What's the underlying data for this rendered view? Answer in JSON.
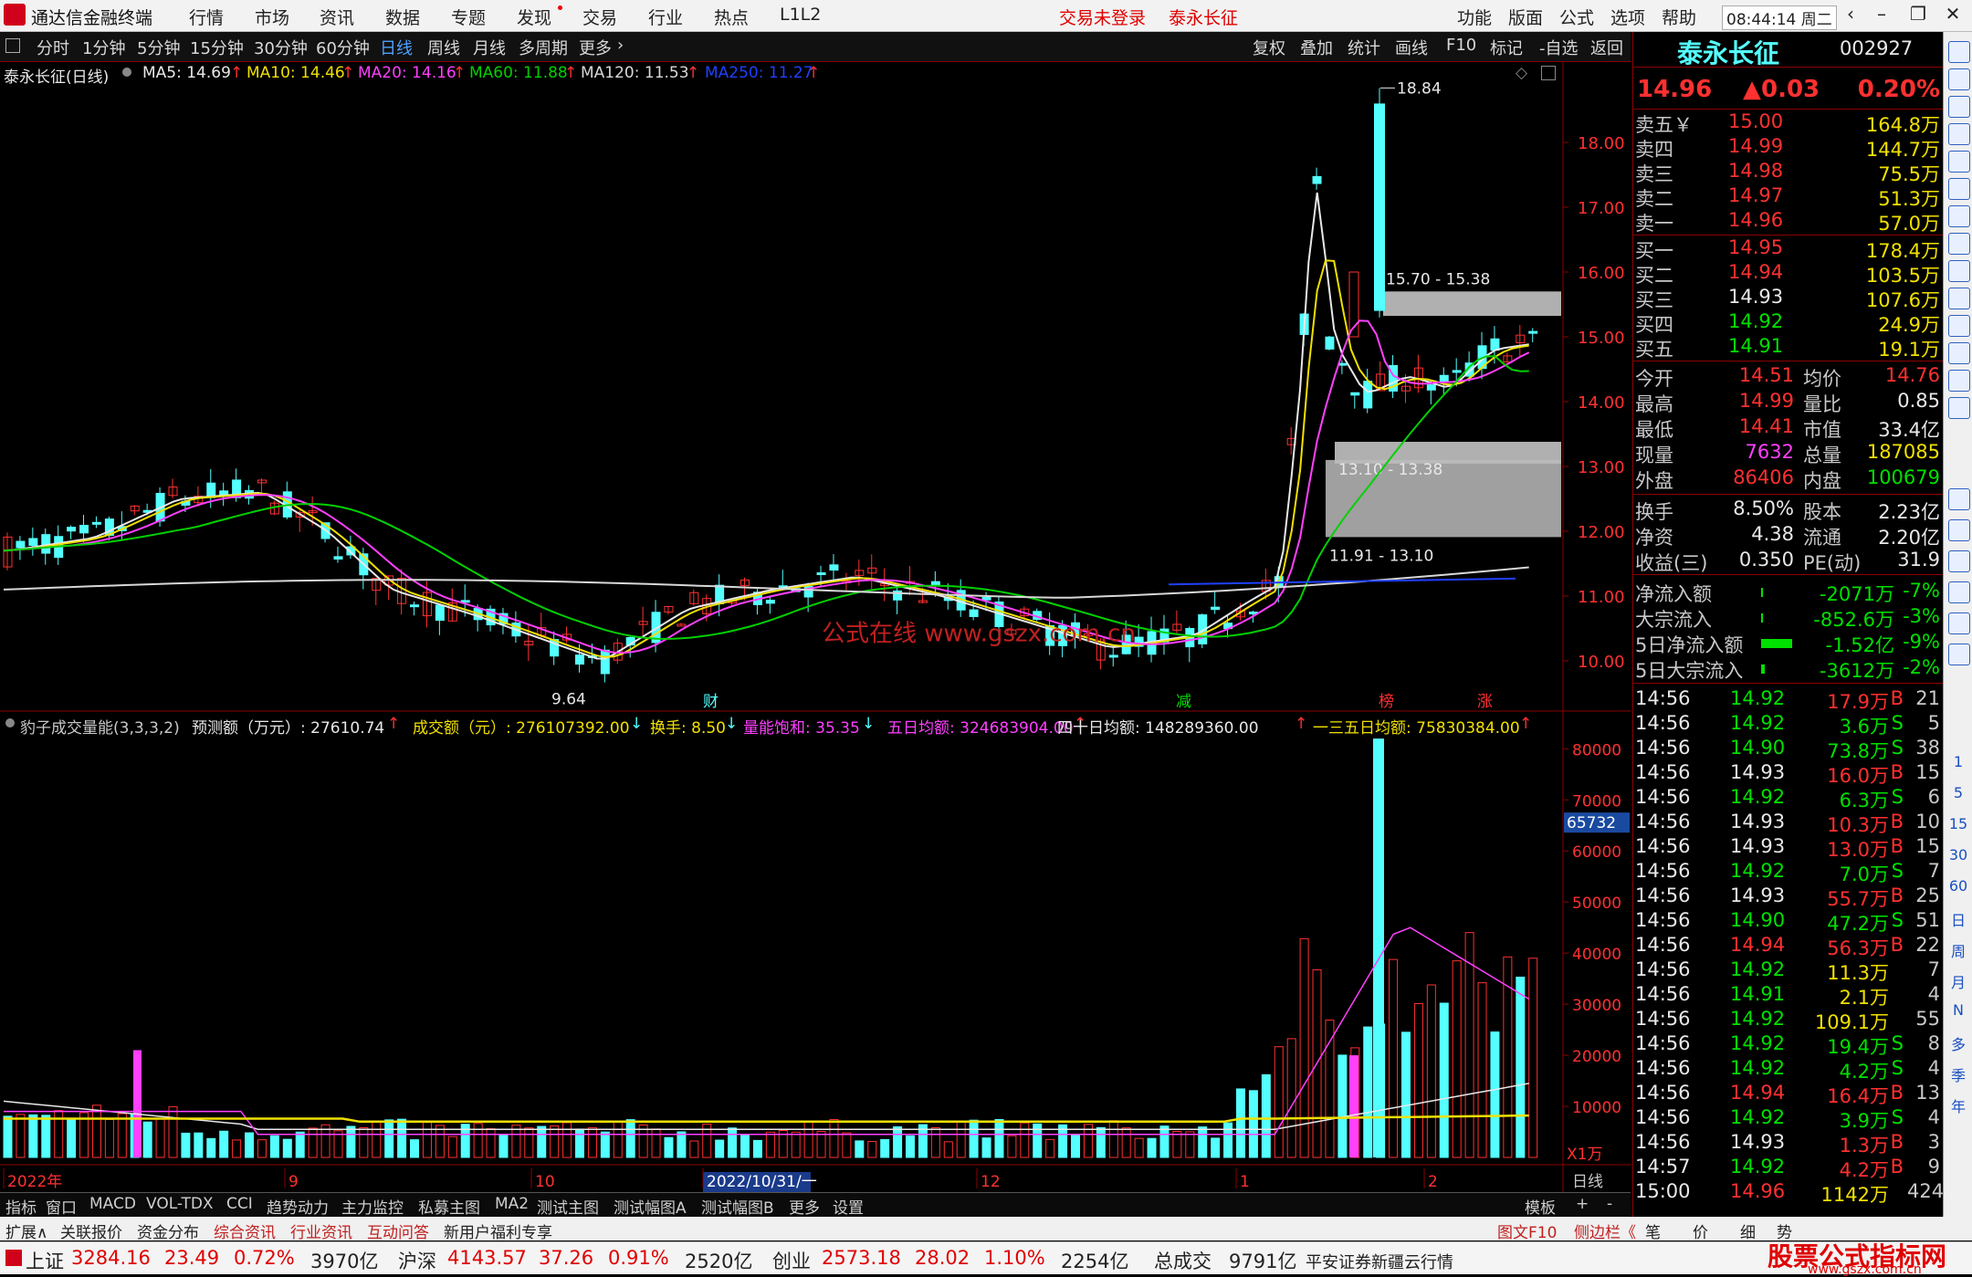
{
  "menubar": {
    "app_title": "通达信金融终端",
    "items": [
      "行情",
      "市场",
      "资讯",
      "数据",
      "专题",
      "发现",
      "交易",
      "行业",
      "热点",
      "L1L2"
    ],
    "status_login": "交易未登录",
    "stock_name": "泰永长征",
    "right_items": [
      "功能",
      "版面",
      "公式",
      "选项",
      "帮助"
    ],
    "time": "08:44:14",
    "weekday": "周二"
  },
  "toolbar": {
    "periods": [
      "分时",
      "1分钟",
      "5分钟",
      "15分钟",
      "30分钟",
      "60分钟",
      "日线",
      "周线",
      "月线",
      "多周期",
      "更多"
    ],
    "active": "日线",
    "right_buttons": [
      "复权",
      "叠加",
      "统计",
      "画线",
      "F10",
      "标记",
      "-自选",
      "返回"
    ]
  },
  "ma_line": {
    "title": "泰永长征(日线)",
    "items": [
      {
        "label": "MA5: 14.69",
        "color": "#e8e8e8"
      },
      {
        "label": "MA10: 14.46",
        "color": "#f0e000"
      },
      {
        "label": "MA20: 14.16",
        "color": "#ff40ff"
      },
      {
        "label": "MA60: 11.88",
        "color": "#00d000"
      },
      {
        "label": "MA120: 11.53",
        "color": "#e0e0e0"
      },
      {
        "label": "MA250: 11.27",
        "color": "#2040ff"
      }
    ]
  },
  "price_axis": [
    "18.00",
    "17.00",
    "16.00",
    "15.00",
    "14.00",
    "13.00",
    "12.00",
    "11.00",
    "10.00"
  ],
  "annotations": {
    "high": "18.84",
    "low": "9.64",
    "zone1": "15.70 - 15.38",
    "zone2": "13.10 - 13.38",
    "zone3": "11.91 - 13.10",
    "watermark": "公式在线  www.gszx.com.cn",
    "markers": [
      "财",
      "减",
      "榜",
      "涨"
    ]
  },
  "volume_header": {
    "title": "豹子成交量能(3,3,3,2)",
    "items": [
      {
        "label": "预测额（万元）: 27610.74",
        "color": "#e8e8e8"
      },
      {
        "label": "成交额（元）: 276107392.00",
        "color": "#f0e000"
      },
      {
        "label": "换手: 8.50",
        "color": "#f0e000"
      },
      {
        "label": "量能饱和: 35.35",
        "color": "#ff40ff"
      },
      {
        "label": "五日均额: 324683904.00",
        "color": "#ff40ff"
      },
      {
        "label": "四十日均额: 148289360.00",
        "color": "#e8e8e8"
      },
      {
        "label": "一三五日均额: 75830384.00",
        "color": "#f0e000"
      }
    ]
  },
  "volume_axis": [
    "80000",
    "70000",
    "60000",
    "50000",
    "40000",
    "30000",
    "20000",
    "10000"
  ],
  "volume_current": "65732",
  "volume_unit": "X1万",
  "date_axis": [
    "2022年",
    "9",
    "10",
    "2022/10/31/一",
    "12",
    "1",
    "2"
  ],
  "date_axis_right": "日线",
  "tabs1": [
    "指标",
    "窗口",
    "MACD",
    "VOL-TDX",
    "CCI",
    "趋势动力",
    "主力监控",
    "私募主图",
    "MA2",
    "测试主图",
    "测试幅图A",
    "测试幅图B",
    "更多",
    "设置"
  ],
  "tabs1_right": [
    "模板",
    "+",
    "-"
  ],
  "tabs2": [
    "扩展∧",
    "关联报价",
    "资金分布",
    "综合资讯",
    "行业资讯",
    "互动问答",
    "新用户福利专享"
  ],
  "tabs2_right": [
    "图文F10",
    "侧边栏《",
    "笔",
    "价",
    "细",
    "势"
  ],
  "statusbar": [
    {
      "label": "上证",
      "value": "3284.16",
      "chg": "23.49",
      "pct": "0.72%",
      "amt": "3970亿"
    },
    {
      "label": "沪深",
      "value": "4143.57",
      "chg": "37.26",
      "pct": "0.91%",
      "amt": "2520亿"
    },
    {
      "label": "创业",
      "value": "2573.18",
      "chg": "28.02",
      "pct": "1.10%",
      "amt": "2254亿"
    }
  ],
  "status_total_label": "总成交",
  "status_total": "9791亿",
  "status_broker": "平安证券新疆云行情",
  "status_brand": "股票公式指标网",
  "status_brand_url": "www.gszx.com.cn",
  "quote": {
    "name": "泰永长征",
    "code": "002927",
    "price": "14.96",
    "change": "▲0.03",
    "pct": "0.20%",
    "asks": [
      {
        "label": "卖五￥",
        "price": "15.00",
        "vol": "164.8万"
      },
      {
        "label": "卖四",
        "price": "14.99",
        "vol": "144.7万"
      },
      {
        "label": "卖三",
        "price": "14.98",
        "vol": "75.5万"
      },
      {
        "label": "卖二",
        "price": "14.97",
        "vol": "51.3万"
      },
      {
        "label": "卖一",
        "price": "14.96",
        "vol": "57.0万"
      }
    ],
    "bids": [
      {
        "label": "买一",
        "price": "14.95",
        "vol": "178.4万"
      },
      {
        "label": "买二",
        "price": "14.94",
        "vol": "103.5万"
      },
      {
        "label": "买三",
        "price": "14.93",
        "vol": "107.6万"
      },
      {
        "label": "买四",
        "price": "14.92",
        "vol": "24.9万"
      },
      {
        "label": "买五",
        "price": "14.91",
        "vol": "19.1万"
      }
    ],
    "stats": [
      {
        "l1": "今开",
        "v1": "14.51",
        "l2": "均价",
        "v2": "14.76"
      },
      {
        "l1": "最高",
        "v1": "14.99",
        "l2": "量比",
        "v2": "0.85"
      },
      {
        "l1": "最低",
        "v1": "14.41",
        "l2": "市值",
        "v2": "33.4亿"
      },
      {
        "l1": "现量",
        "v1": "7632",
        "l2": "总量",
        "v2": "187085"
      },
      {
        "l1": "外盘",
        "v1": "86406",
        "l2": "内盘",
        "v2": "100679"
      }
    ],
    "stats2": [
      {
        "l1": "换手",
        "v1": "8.50%",
        "l2": "股本",
        "v2": "2.23亿"
      },
      {
        "l1": "净资",
        "v1": "4.38",
        "l2": "流通",
        "v2": "2.20亿"
      },
      {
        "l1": "收益(三)",
        "v1": "0.350",
        "l2": "PE(动)",
        "v2": "31.9"
      }
    ],
    "flows": [
      {
        "label": "净流入额",
        "value": "-2071万",
        "pct": "-7%"
      },
      {
        "label": "大宗流入",
        "value": "-852.6万",
        "pct": "-3%"
      },
      {
        "label": "5日净流入额",
        "value": "-1.52亿",
        "pct": "-9%"
      },
      {
        "label": "5日大宗流入",
        "value": "-3612万",
        "pct": "-2%"
      }
    ],
    "ticks": [
      {
        "t": "14:56",
        "p": "14.92",
        "v": "17.9万",
        "s": "B",
        "n": "21"
      },
      {
        "t": "14:56",
        "p": "14.92",
        "v": "3.6万",
        "s": "S",
        "n": "5"
      },
      {
        "t": "14:56",
        "p": "14.90",
        "v": "73.8万",
        "s": "S",
        "n": "38"
      },
      {
        "t": "14:56",
        "p": "14.93",
        "v": "16.0万",
        "s": "B",
        "n": "15"
      },
      {
        "t": "14:56",
        "p": "14.92",
        "v": "6.3万",
        "s": "S",
        "n": "6"
      },
      {
        "t": "14:56",
        "p": "14.93",
        "v": "10.3万",
        "s": "B",
        "n": "10"
      },
      {
        "t": "14:56",
        "p": "14.93",
        "v": "13.0万",
        "s": "B",
        "n": "15"
      },
      {
        "t": "14:56",
        "p": "14.92",
        "v": "7.0万",
        "s": "S",
        "n": "7"
      },
      {
        "t": "14:56",
        "p": "14.93",
        "v": "55.7万",
        "s": "B",
        "n": "25"
      },
      {
        "t": "14:56",
        "p": "14.90",
        "v": "47.2万",
        "s": "S",
        "n": "51"
      },
      {
        "t": "14:56",
        "p": "14.94",
        "v": "56.3万",
        "s": "B",
        "n": "22"
      },
      {
        "t": "14:56",
        "p": "14.92",
        "v": "11.3万",
        "s": "",
        "n": "7"
      },
      {
        "t": "14:56",
        "p": "14.91",
        "v": "2.1万",
        "s": "",
        "n": "4"
      },
      {
        "t": "14:56",
        "p": "14.92",
        "v": "109.1万",
        "s": "",
        "n": "55"
      },
      {
        "t": "14:56",
        "p": "14.92",
        "v": "19.4万",
        "s": "S",
        "n": "8"
      },
      {
        "t": "14:56",
        "p": "14.92",
        "v": "4.2万",
        "s": "S",
        "n": "4"
      },
      {
        "t": "14:56",
        "p": "14.94",
        "v": "16.4万",
        "s": "B",
        "n": "13"
      },
      {
        "t": "14:56",
        "p": "14.92",
        "v": "3.9万",
        "s": "S",
        "n": "4"
      },
      {
        "t": "14:56",
        "p": "14.93",
        "v": "1.3万",
        "s": "B",
        "n": "3"
      },
      {
        "t": "14:57",
        "p": "14.92",
        "v": "4.2万",
        "s": "B",
        "n": "9"
      },
      {
        "t": "15:00",
        "p": "14.96",
        "v": "1142万",
        "s": "",
        "n": "424"
      }
    ]
  },
  "side_labels": [
    "1",
    "5",
    "15",
    "30",
    "60",
    "日",
    "周",
    "月",
    "N",
    "多",
    "季",
    "年"
  ],
  "colors": {
    "up": "#ff3030",
    "down": "#54ffff",
    "ma5": "#e8e8e8",
    "ma10": "#f0e000",
    "ma20": "#ff40ff",
    "ma60": "#00d000",
    "ma120": "#d8d8d8",
    "ma250": "#2040ff",
    "grid": "#8b0000"
  }
}
